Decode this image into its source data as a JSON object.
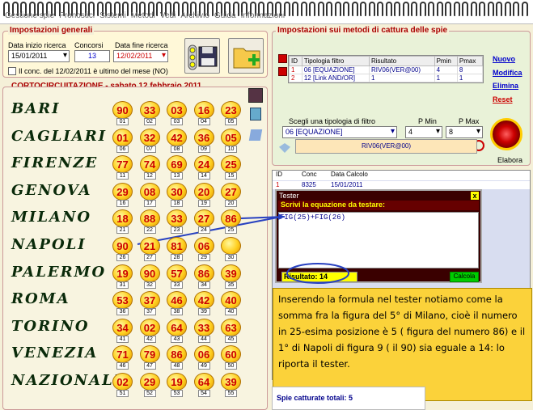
{
  "menu": [
    "Gestione spie",
    "Pronostici",
    "Sistemi",
    "Metodi",
    "Vedi",
    "Archivio",
    "Guida",
    "Informazioni"
  ],
  "impostazioni": {
    "title": "Impostazioni generali",
    "data_inizio_label": "Data inizio ricerca",
    "data_inizio": "15/01/2011",
    "concorsi_label": "Concorsi",
    "concorsi": "13",
    "data_fine_label": "Data fine ricerca",
    "data_fine": "12/02/2011",
    "check_label": "Il conc. del 12/02/2011 è ultimo del mese (NO)"
  },
  "corto_title": "CORTOCIRCUITAZIONE - sabato 12 febbraio 2011",
  "wheels": [
    {
      "name": "BARI",
      "nums": [
        "90",
        "33",
        "03",
        "16",
        "23"
      ],
      "pos": [
        "01",
        "02",
        "03",
        "04",
        "05"
      ]
    },
    {
      "name": "CAGLIARI",
      "nums": [
        "01",
        "32",
        "42",
        "36",
        "05"
      ],
      "pos": [
        "06",
        "07",
        "08",
        "09",
        "10"
      ]
    },
    {
      "name": "FIRENZE",
      "nums": [
        "77",
        "74",
        "69",
        "24",
        "25"
      ],
      "pos": [
        "11",
        "12",
        "13",
        "14",
        "15"
      ]
    },
    {
      "name": "GENOVA",
      "nums": [
        "29",
        "08",
        "30",
        "20",
        "27"
      ],
      "pos": [
        "16",
        "17",
        "18",
        "19",
        "20"
      ]
    },
    {
      "name": "MILANO",
      "nums": [
        "18",
        "88",
        "33",
        "27",
        "86"
      ],
      "pos": [
        "21",
        "22",
        "23",
        "24",
        "25"
      ]
    },
    {
      "name": "NAPOLI",
      "nums": [
        "90",
        "21",
        "81",
        "06"
      ],
      "pos": [
        "26",
        "27",
        "28",
        "29",
        "30"
      ]
    },
    {
      "name": "PALERMO",
      "nums": [
        "19",
        "90",
        "57",
        "86",
        "39"
      ],
      "pos": [
        "31",
        "32",
        "33",
        "34",
        "35"
      ]
    },
    {
      "name": "ROMA",
      "nums": [
        "53",
        "37",
        "46",
        "42",
        "40"
      ],
      "pos": [
        "36",
        "37",
        "38",
        "39",
        "40"
      ]
    },
    {
      "name": "TORINO",
      "nums": [
        "34",
        "02",
        "64",
        "33",
        "63"
      ],
      "pos": [
        "41",
        "42",
        "43",
        "44",
        "45"
      ]
    },
    {
      "name": "VENEZIA",
      "nums": [
        "71",
        "79",
        "86",
        "06",
        "60"
      ],
      "pos": [
        "46",
        "47",
        "48",
        "49",
        "50"
      ]
    },
    {
      "name": "NAZIONALE",
      "nums": [
        "02",
        "29",
        "19",
        "64",
        "39"
      ],
      "pos": [
        "51",
        "52",
        "53",
        "54",
        "55"
      ]
    }
  ],
  "spie": {
    "title": "Impostazioni sui metodi di cattura delle spie",
    "headers": [
      "ID",
      "Tipologia filtro",
      "Risultato",
      "Pmin",
      "Pmax"
    ],
    "rows": [
      [
        "1",
        "06 [EQUAZIONE]",
        "RIV06(VER@00)",
        "4",
        "8"
      ],
      [
        "2",
        "12 [Link AND/OR]",
        "1",
        "1",
        "1"
      ]
    ],
    "links": {
      "nuovo": "Nuovo",
      "modifica": "Modifica",
      "elimina": "Elimina",
      "reset": "Reset"
    },
    "scegli_label": "Scegli una tipologia di filtro",
    "pmin_label": "P Min",
    "pmax_label": "P Max",
    "filtro_value": "06 [EQUAZIONE]",
    "pmin_value": "4",
    "pmax_value": "8",
    "riv_value": "RIV06(VER@00)",
    "elabora": "Elabora"
  },
  "calc": {
    "headers": [
      "ID",
      "Conc",
      "Data Calcolo"
    ],
    "row": [
      "1",
      "8325",
      "15/01/2011"
    ]
  },
  "tester": {
    "title": "Tester",
    "close": "x",
    "prompt": "Scrivi la equazione da testare:",
    "equation": "FIG(25)+FIG(26)",
    "result": "Risultato: 14",
    "calcola": "Calcola"
  },
  "note": "Inserendo la formula nel tester notiamo come la somma fra la figura del 5° di Milano, cioè il numero in 25-esima posizione è 5 ( figura del numero 86)  e il 1° di Napoli di figura 9 ( il 90) sia eguale a 14: lo riporta il tester.",
  "totali": "Spie catturate totali: 5"
}
